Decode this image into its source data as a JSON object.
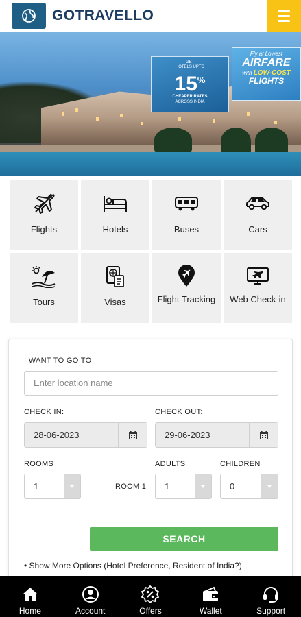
{
  "header": {
    "brand": "GOTRAVELLO",
    "logo_icon": "globe-icon",
    "menu_icon": "hamburger-icon",
    "colors": {
      "brand_text": "#1d3c61",
      "menu_bg": "#f9c315",
      "logo_bg": "#1f5f86"
    }
  },
  "banner": {
    "promo_left": {
      "line1": "GET",
      "line2": "HOTELS UPTO",
      "percent": "15",
      "percent_sign": "%",
      "line3": "CHEAPER RATES",
      "line4": "ACROSS INDIA"
    },
    "promo_right": {
      "line1": "Fly at Lowest",
      "line2": "AIRFARE",
      "line3_pre": "with",
      "line3_hl": "LOW-COST",
      "line4": "FLIGHTS"
    }
  },
  "services": [
    {
      "label": "Flights",
      "icon": "airplane-icon"
    },
    {
      "label": "Hotels",
      "icon": "bed-icon"
    },
    {
      "label": "Buses",
      "icon": "bus-icon"
    },
    {
      "label": "Cars",
      "icon": "car-icon"
    },
    {
      "label": "Tours",
      "icon": "beach-umbrella-icon"
    },
    {
      "label": "Visas",
      "icon": "passport-icon"
    },
    {
      "label": "Flight Tracking",
      "icon": "location-pin-plane-icon"
    },
    {
      "label": "Web Check-in",
      "icon": "monitor-plane-icon"
    }
  ],
  "search": {
    "destination_label": "I WANT TO GO TO",
    "destination_placeholder": "Enter location name",
    "checkin_label": "CHECK IN:",
    "checkin_value": "28-06-2023",
    "checkout_label": "CHECK OUT:",
    "checkout_value": "29-06-2023",
    "rooms_label": "ROOMS",
    "rooms_value": "1",
    "room_row_label": "ROOM 1",
    "adults_label": "ADULTS",
    "adults_value": "1",
    "children_label": "CHILDREN",
    "children_value": "0",
    "search_button": "SEARCH",
    "more_options": "• Show More Options (Hotel Preference, Resident of India?)",
    "colors": {
      "search_bg": "#5cb85c"
    }
  },
  "bottom_nav": [
    {
      "label": "Home",
      "icon": "home-icon"
    },
    {
      "label": "Account",
      "icon": "user-icon"
    },
    {
      "label": "Offers",
      "icon": "discount-icon"
    },
    {
      "label": "Wallet",
      "icon": "wallet-icon"
    },
    {
      "label": "Support",
      "icon": "headset-icon"
    }
  ]
}
